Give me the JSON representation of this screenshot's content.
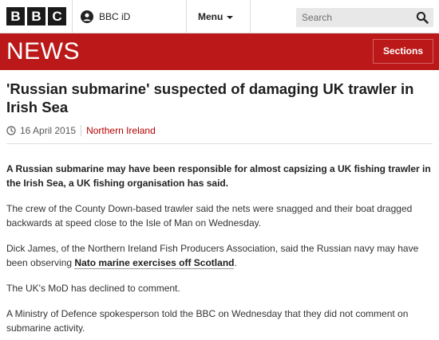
{
  "masthead": {
    "logo_letters": [
      "B",
      "B",
      "C"
    ],
    "bbcid_label": "BBC iD",
    "menu_label": "Menu",
    "search_placeholder": "Search"
  },
  "banner": {
    "wordmark": "NEWS",
    "sections_label": "Sections"
  },
  "article": {
    "headline": "'Russian submarine' suspected of damaging UK trawler in Irish Sea",
    "date": "16 April 2015",
    "section_link": "Northern Ireland",
    "lead": "A Russian submarine may have been responsible for almost capsizing a UK fishing trawler in the Irish Sea, a UK fishing organisation has said.",
    "para1": "The crew of the County Down-based trawler said the nets were snagged and their boat dragged backwards at speed close to the Isle of Man on Wednesday.",
    "para2_prefix": "Dick James, of the Northern Ireland Fish Producers Association, said the Russian navy may have been observing ",
    "para2_link": "Nato marine exercises off Scotland",
    "para2_suffix": ".",
    "para3": "The UK's MoD has declined to comment.",
    "para4": "A Ministry of Defence spokesperson told the BBC on Wednesday that they did not comment on submarine activity."
  },
  "colors": {
    "news_red": "#bb1919",
    "link_red": "#b80000",
    "logo_black": "#1a1a1a"
  },
  "icons": {
    "bbcid": "person-circle-icon",
    "search": "magnifier-icon",
    "date": "clock-icon",
    "menu": "chevron-down-icon"
  }
}
